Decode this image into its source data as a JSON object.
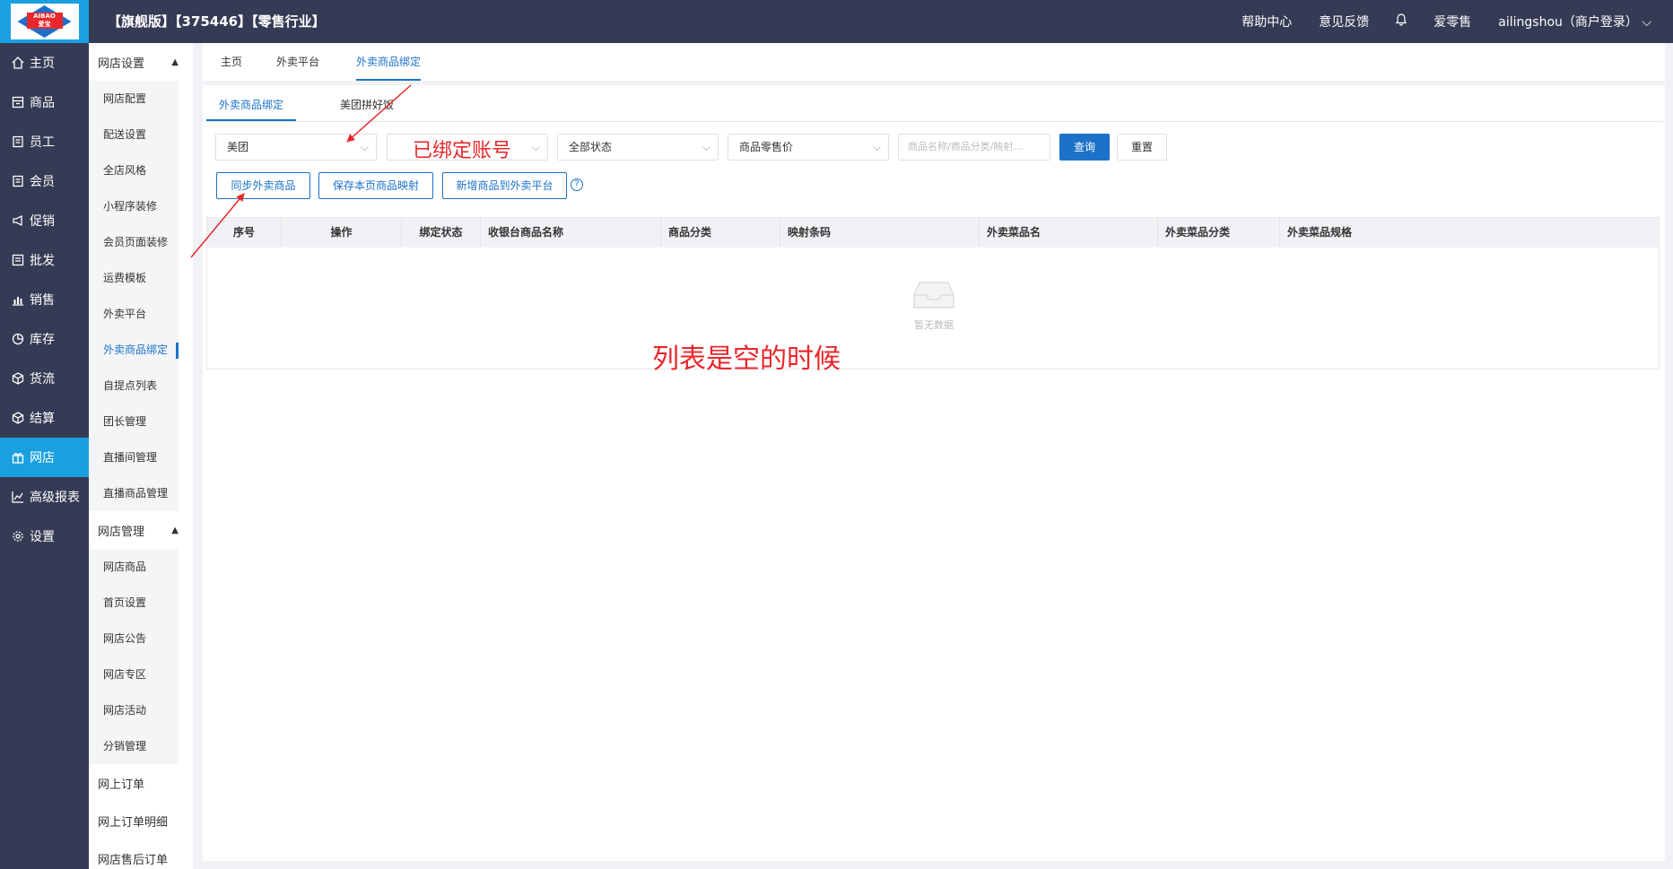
{
  "header": {
    "logo_text_top": "AIBAO",
    "logo_text_bottom": "爱宝",
    "title": "【旗舰版】【375446】【零售行业】",
    "help": "帮助中心",
    "feedback": "意见反馈",
    "brand": "爱零售",
    "user": "ailingshou（商户登录）"
  },
  "sidebar": {
    "items": [
      {
        "label": "主页",
        "icon": "home-icon"
      },
      {
        "label": "商品",
        "icon": "goods-icon"
      },
      {
        "label": "员工",
        "icon": "staff-icon"
      },
      {
        "label": "会员",
        "icon": "member-icon"
      },
      {
        "label": "促销",
        "icon": "megaphone-icon"
      },
      {
        "label": "批发",
        "icon": "wholesale-icon"
      },
      {
        "label": "销售",
        "icon": "bar-chart-icon"
      },
      {
        "label": "库存",
        "icon": "pie-chart-icon"
      },
      {
        "label": "货流",
        "icon": "cube-icon"
      },
      {
        "label": "结算",
        "icon": "settle-icon"
      },
      {
        "label": "网店",
        "icon": "gift-icon"
      },
      {
        "label": "高级报表",
        "icon": "line-chart-icon"
      },
      {
        "label": "设置",
        "icon": "gear-icon"
      }
    ],
    "active": "网店"
  },
  "subsidebar": {
    "group1": "网店设置",
    "group1_items": [
      "网店配置",
      "配送设置",
      "全店风格",
      "小程序装修",
      "会员页面装修",
      "运费模板",
      "外卖平台",
      "外卖商品绑定",
      "自提点列表",
      "团长管理",
      "直播间管理",
      "直播商品管理"
    ],
    "group2": "网店管理",
    "group2_items": [
      "网店商品",
      "首页设置",
      "网店公告",
      "网店专区",
      "网店活动",
      "分销管理"
    ],
    "extra": [
      "网上订单",
      "网上订单明细",
      "网店售后订单"
    ]
  },
  "topnav": {
    "tabs": [
      "主页",
      "外卖平台",
      "外卖商品绑定"
    ],
    "active": "外卖商品绑定"
  },
  "subtabs": {
    "tab1": "外卖商品绑定",
    "tab2": "美团拼好饭"
  },
  "filters": {
    "platform": "美团",
    "account": "",
    "status": "全部状态",
    "price": "商品零售价",
    "search_placeholder": "商品名称/商品分类/映射..."
  },
  "buttons": {
    "query": "查询",
    "reset": "重置",
    "sync": "同步外卖商品",
    "save": "保存本页商品映射",
    "add": "新增商品到外卖平台",
    "help": "?"
  },
  "table": {
    "columns": [
      "序号",
      "操作",
      "绑定状态",
      "收银台商品名称",
      "商品分类",
      "映射条码",
      "外卖菜品名",
      "外卖菜品分类",
      "外卖菜品规格"
    ],
    "empty_text": "暂无数据"
  },
  "annotations": {
    "account": "已绑定账号",
    "empty": "列表是空的时候"
  },
  "colors": {
    "dark_nav": "#363b55",
    "active_blue": "#1aa0e0",
    "primary": "#1b72c8",
    "annotation_red": "#e8272b"
  }
}
